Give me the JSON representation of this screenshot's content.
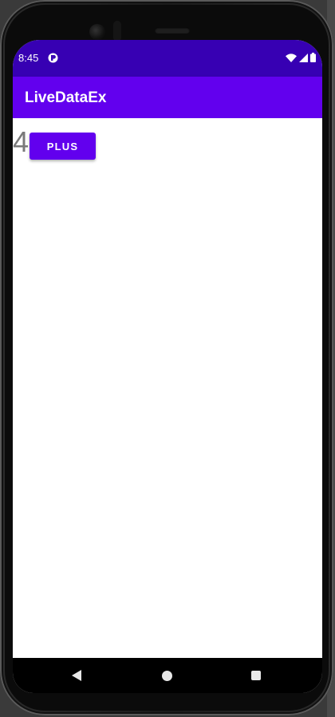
{
  "status_bar": {
    "time": "8:45",
    "notification_icon": "app-notification-icon",
    "right_icons": [
      "wifi-icon",
      "cell-signal-icon",
      "battery-icon"
    ],
    "color": "#3700B3"
  },
  "app_bar": {
    "title": "LiveDataEx",
    "color": "#6200EE"
  },
  "main": {
    "counter_value": "4",
    "plus_button_label": "PLUS"
  },
  "nav_bar": {
    "icons": [
      "back-icon",
      "home-icon",
      "recents-icon"
    ]
  }
}
